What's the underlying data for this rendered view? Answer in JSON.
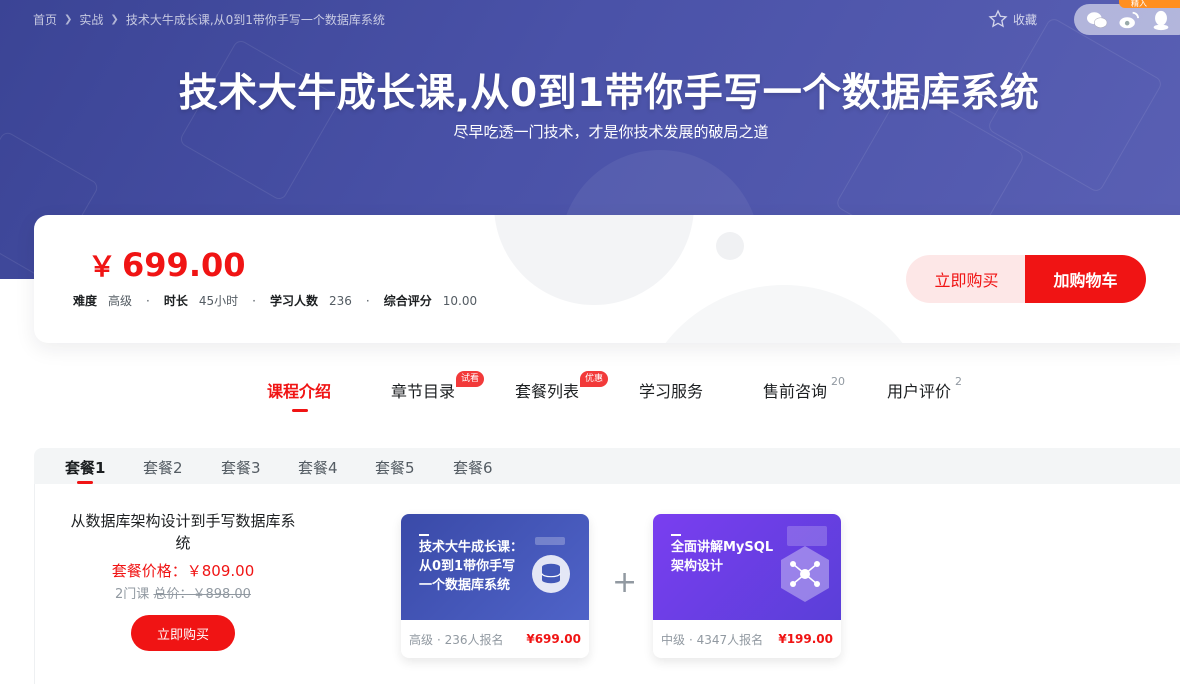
{
  "breadcrumb": {
    "items": [
      "首页",
      "实战",
      "技术大牛成长课,从0到1带你手写一个数据库系统"
    ]
  },
  "header": {
    "favorite": "收藏",
    "corner_label": "精入"
  },
  "hero": {
    "title": "技术大牛成长课,从0到1带你手写一个数据库系统",
    "subtitle": "尽早吃透一门技术，才是你技术发展的破局之道"
  },
  "pricing": {
    "currency": "￥",
    "price": "699.00",
    "meta": [
      {
        "label": "难度",
        "value": "高级"
      },
      {
        "label": "时长",
        "value": "45小时"
      },
      {
        "label": "学习人数",
        "value": "236"
      },
      {
        "label": "综合评分",
        "value": "10.00"
      }
    ],
    "buy_now": "立即购买",
    "add_cart": "加购物车"
  },
  "tabs": [
    {
      "label": "课程介绍"
    },
    {
      "label": "章节目录",
      "badge": "试看"
    },
    {
      "label": "套餐列表",
      "badge": "优惠"
    },
    {
      "label": "学习服务"
    },
    {
      "label": "售前咨询",
      "count": "20"
    },
    {
      "label": "用户评价",
      "count": "2"
    }
  ],
  "packages": {
    "tabs": [
      "套餐1",
      "套餐2",
      "套餐3",
      "套餐4",
      "套餐5",
      "套餐6"
    ],
    "info": {
      "name": "从数据库架构设计到手写数据库系统",
      "price_label": "套餐价格：￥809.00",
      "count": "2门课",
      "original": "总价：￥898.00",
      "buy": "立即购买"
    },
    "courses": [
      {
        "title_l1": "技术大牛成长课：",
        "title_l2": "从0到1带你手写",
        "title_l3": "一个数据库系统",
        "level": "高级",
        "enroll": "· 236人报名",
        "price": "¥699.00"
      },
      {
        "title_l1": "全面讲解MySQL",
        "title_l2": "架构设计",
        "title_l3": "",
        "level": "中级",
        "enroll": "· 4347人报名",
        "price": "¥199.00"
      }
    ],
    "plus": "+"
  },
  "colors": {
    "accent": "#f01414",
    "hero": "#4a52a8"
  }
}
